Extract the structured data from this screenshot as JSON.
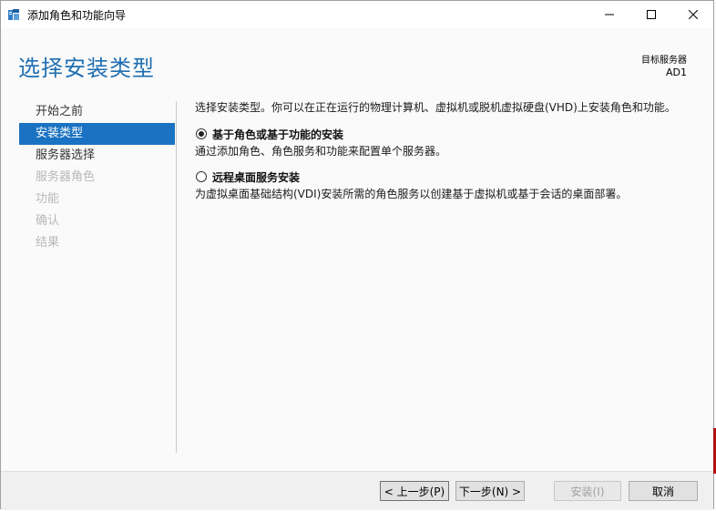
{
  "window": {
    "title": "添加角色和功能向导"
  },
  "header": {
    "title": "选择安装类型",
    "target_label": "目标服务器",
    "target_value": "AD1"
  },
  "nav": {
    "items": [
      {
        "label": "开始之前",
        "state": "done"
      },
      {
        "label": "安装类型",
        "state": "active"
      },
      {
        "label": "服务器选择",
        "state": "done"
      },
      {
        "label": "服务器角色",
        "state": "disabled"
      },
      {
        "label": "功能",
        "state": "disabled"
      },
      {
        "label": "确认",
        "state": "disabled"
      },
      {
        "label": "结果",
        "state": "disabled"
      }
    ]
  },
  "content": {
    "intro": "选择安装类型。你可以在正在运行的物理计算机、虚拟机或脱机虚拟硬盘(VHD)上安装角色和功能。",
    "options": [
      {
        "title": "基于角色或基于功能的安装",
        "description": "通过添加角色、角色服务和功能来配置单个服务器。",
        "selected": true
      },
      {
        "title": "远程桌面服务安装",
        "description": "为虚拟桌面基础结构(VDI)安装所需的角色服务以创建基于虚拟机或基于会话的桌面部署。",
        "selected": false
      }
    ]
  },
  "footer": {
    "prev_label": "< 上一步(P)",
    "next_label": "下一步(N) >",
    "install_label": "安装(I)",
    "cancel_label": "取消"
  },
  "colors": {
    "accent": "#1a73c2",
    "title_blue": "#1f6fb2",
    "disabled_text": "#b8b8b8"
  }
}
